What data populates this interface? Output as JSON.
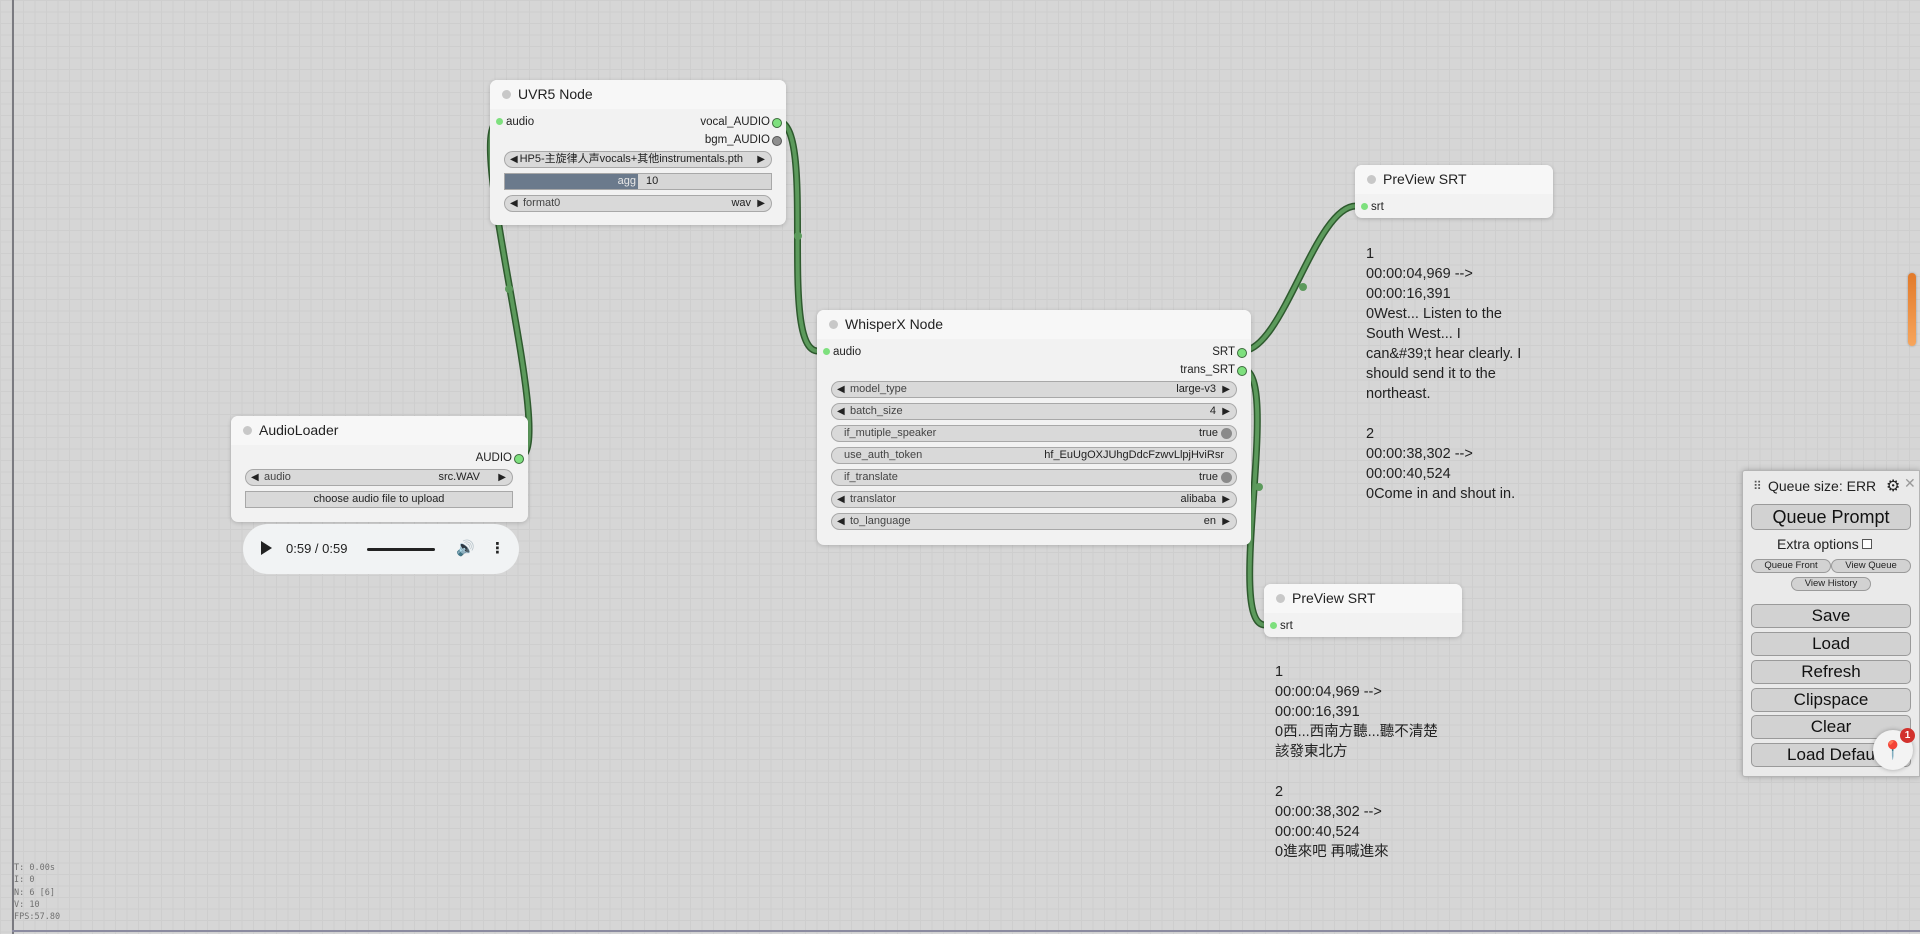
{
  "nodes": {
    "uvr5": {
      "title": "UVR5 Node",
      "input_audio": "audio",
      "output_vocal": "vocal_AUDIO",
      "output_bgm": "bgm_AUDIO",
      "model_value": "HP5-主旋律人声vocals+其他instrumentals.pth",
      "agg_label": "agg",
      "agg_value": "10",
      "agg_fraction": 0.5,
      "format_label": "format0",
      "format_value": "wav"
    },
    "audio_loader": {
      "title": "AudioLoader",
      "output_audio": "AUDIO",
      "audio_label": "audio",
      "audio_value": "src.WAV",
      "upload_label": "choose audio file to upload",
      "player_time": "0:59 / 0:59"
    },
    "whisperx": {
      "title": "WhisperX Node",
      "input_audio": "audio",
      "output_srt": "SRT",
      "output_trans_srt": "trans_SRT",
      "widgets": [
        {
          "name": "model_type",
          "value": "large-v3"
        },
        {
          "name": "batch_size",
          "value": "4"
        },
        {
          "name": "if_mutiple_speaker",
          "value": "true"
        },
        {
          "name": "use_auth_token",
          "value": "hf_EuUgOXJUhgDdcFzwvLlpjHviRsr"
        },
        {
          "name": "if_translate",
          "value": "true"
        },
        {
          "name": "translator",
          "value": "alibaba"
        },
        {
          "name": "to_language",
          "value": "en"
        }
      ]
    },
    "preview1": {
      "title": "PreView SRT",
      "input_srt": "srt",
      "text": "1\n00:00:04,969 -->\n00:00:16,391\n0West... Listen to the\nSouth West... I\ncan&#39;t hear clearly. I\nshould send it to the\nnortheast.\n\n2\n00:00:38,302 -->\n00:00:40,524\n0Come in and shout in."
    },
    "preview2": {
      "title": "PreView SRT",
      "input_srt": "srt",
      "text": "1\n00:00:04,969 -->\n00:00:16,391\n0西...西南方聽...聽不清楚\n該發東北方\n\n2\n00:00:38,302 -->\n00:00:40,524\n0進來吧 再喊進來"
    }
  },
  "stats": "T: 0.00s\nI: 0\nN: 6 [6]\nV: 10\nFPS:57.80",
  "menu": {
    "queue_size": "Queue size: ERR",
    "queue_prompt": "Queue Prompt",
    "extra_options": "Extra options",
    "queue_front": "Queue Front",
    "view_queue": "View Queue",
    "view_history": "View History",
    "save": "Save",
    "load": "Load",
    "refresh": "Refresh",
    "clipspace": "Clipspace",
    "clear": "Clear",
    "load_default": "Load Defau"
  },
  "notification_count": "1",
  "colors": {
    "link": "#3f7a3f",
    "slot_active": "#7ee07e",
    "canvas": "#d6d6d6",
    "scroll_accent": "#e27a2a"
  }
}
